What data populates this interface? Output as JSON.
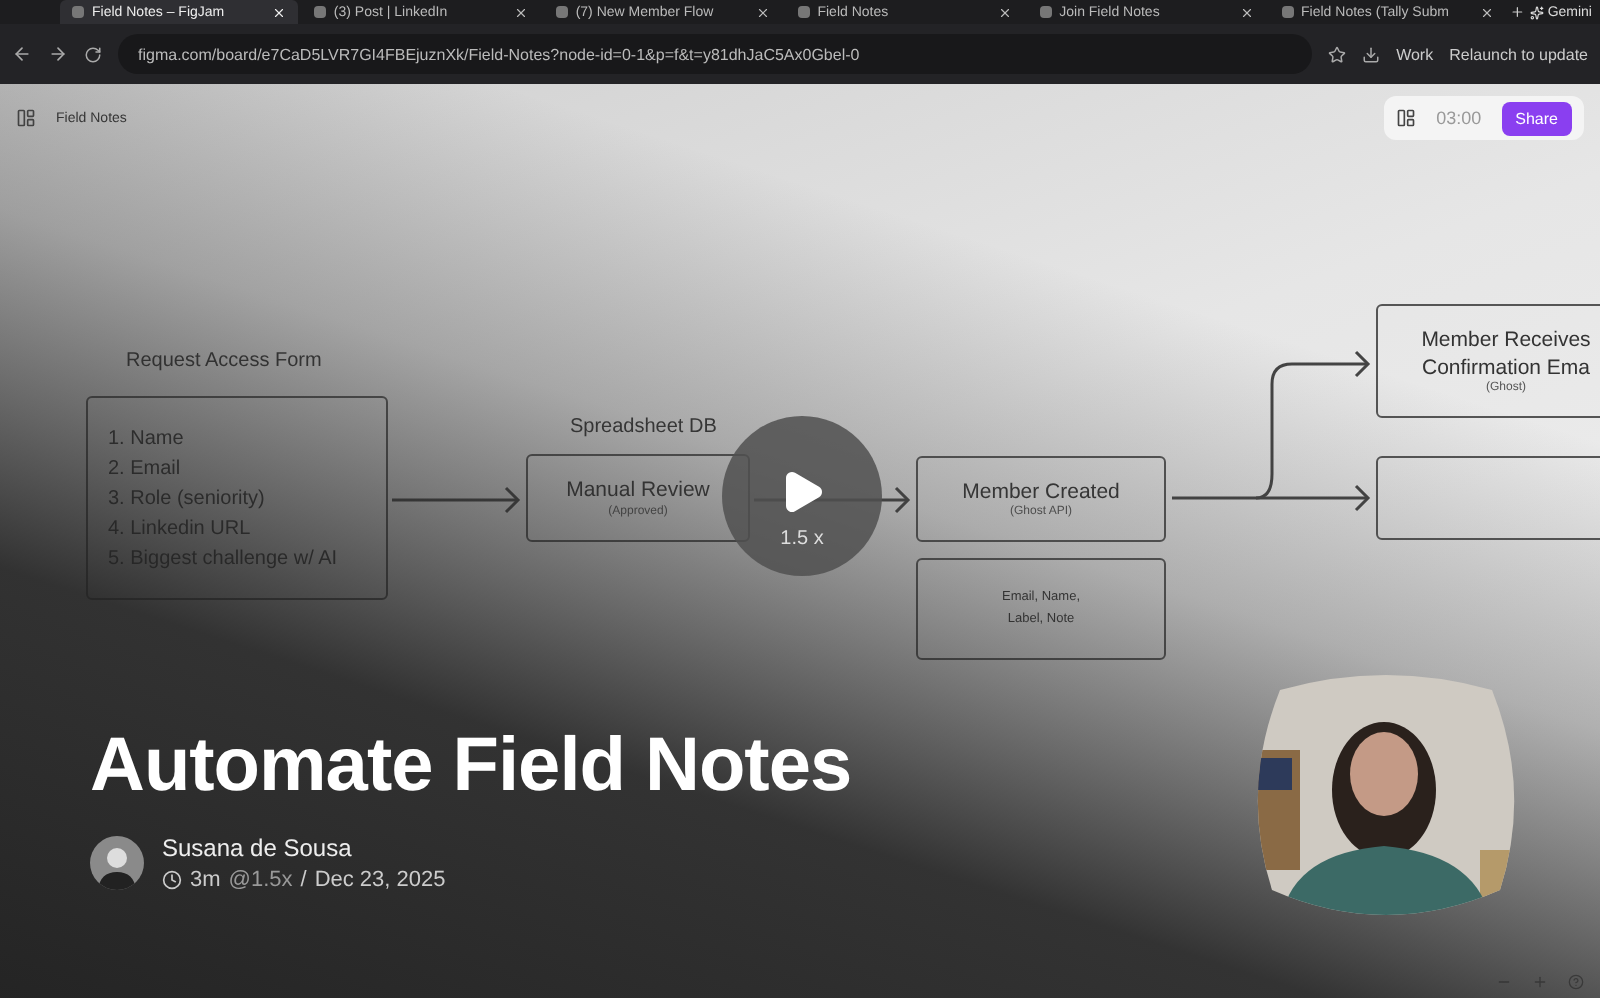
{
  "browser": {
    "tabs": [
      {
        "title": "Field Notes – FigJam",
        "selected": true
      },
      {
        "title": "(3) Post | LinkedIn",
        "selected": false
      },
      {
        "title": "(7) New Member Flow",
        "selected": false
      },
      {
        "title": "Field Notes",
        "selected": false
      },
      {
        "title": "Join Field Notes",
        "selected": false
      },
      {
        "title": "Field Notes (Tally Subm",
        "selected": false
      }
    ],
    "gemini": "Gemini",
    "url": "figma.com/board/e7CaD5LVR7GI4FBEjuznXk/Field-Notes?node-id=0-1&p=f&t=y81dhJaC5Ax0Gbel-0",
    "profile": "Work",
    "relaunch": "Relaunch to update"
  },
  "figma": {
    "file_name": "Field Notes",
    "timer": "03:00",
    "share": "Share"
  },
  "diagram": {
    "nodes": [
      {
        "kind": "list",
        "heading": "Request Access Form",
        "items": [
          "1. Name",
          "2. Email",
          "3. Role (seniority)",
          "4. Linkedin URL",
          "5. Biggest challenge w/ AI"
        ]
      },
      {
        "kind": "box",
        "heading": "Spreadsheet DB",
        "title": "Manual Review",
        "subtitle": "(Approved)"
      },
      {
        "kind": "box",
        "title": "Member Created",
        "subtitle": "(Ghost API)"
      },
      {
        "kind": "note",
        "lines": [
          "Email, Name,",
          "Label, Note"
        ]
      },
      {
        "kind": "box",
        "title": "Member Receives\nConfirmation Ema",
        "subtitle": "(Ghost)"
      },
      {
        "kind": "box"
      }
    ]
  },
  "video": {
    "speed": "1.5 x",
    "title": "Automate Field Notes",
    "author": "Susana de Sousa",
    "duration": "3m",
    "speed_note": "@1.5x",
    "separator": "/",
    "date": "Dec 23, 2025"
  }
}
